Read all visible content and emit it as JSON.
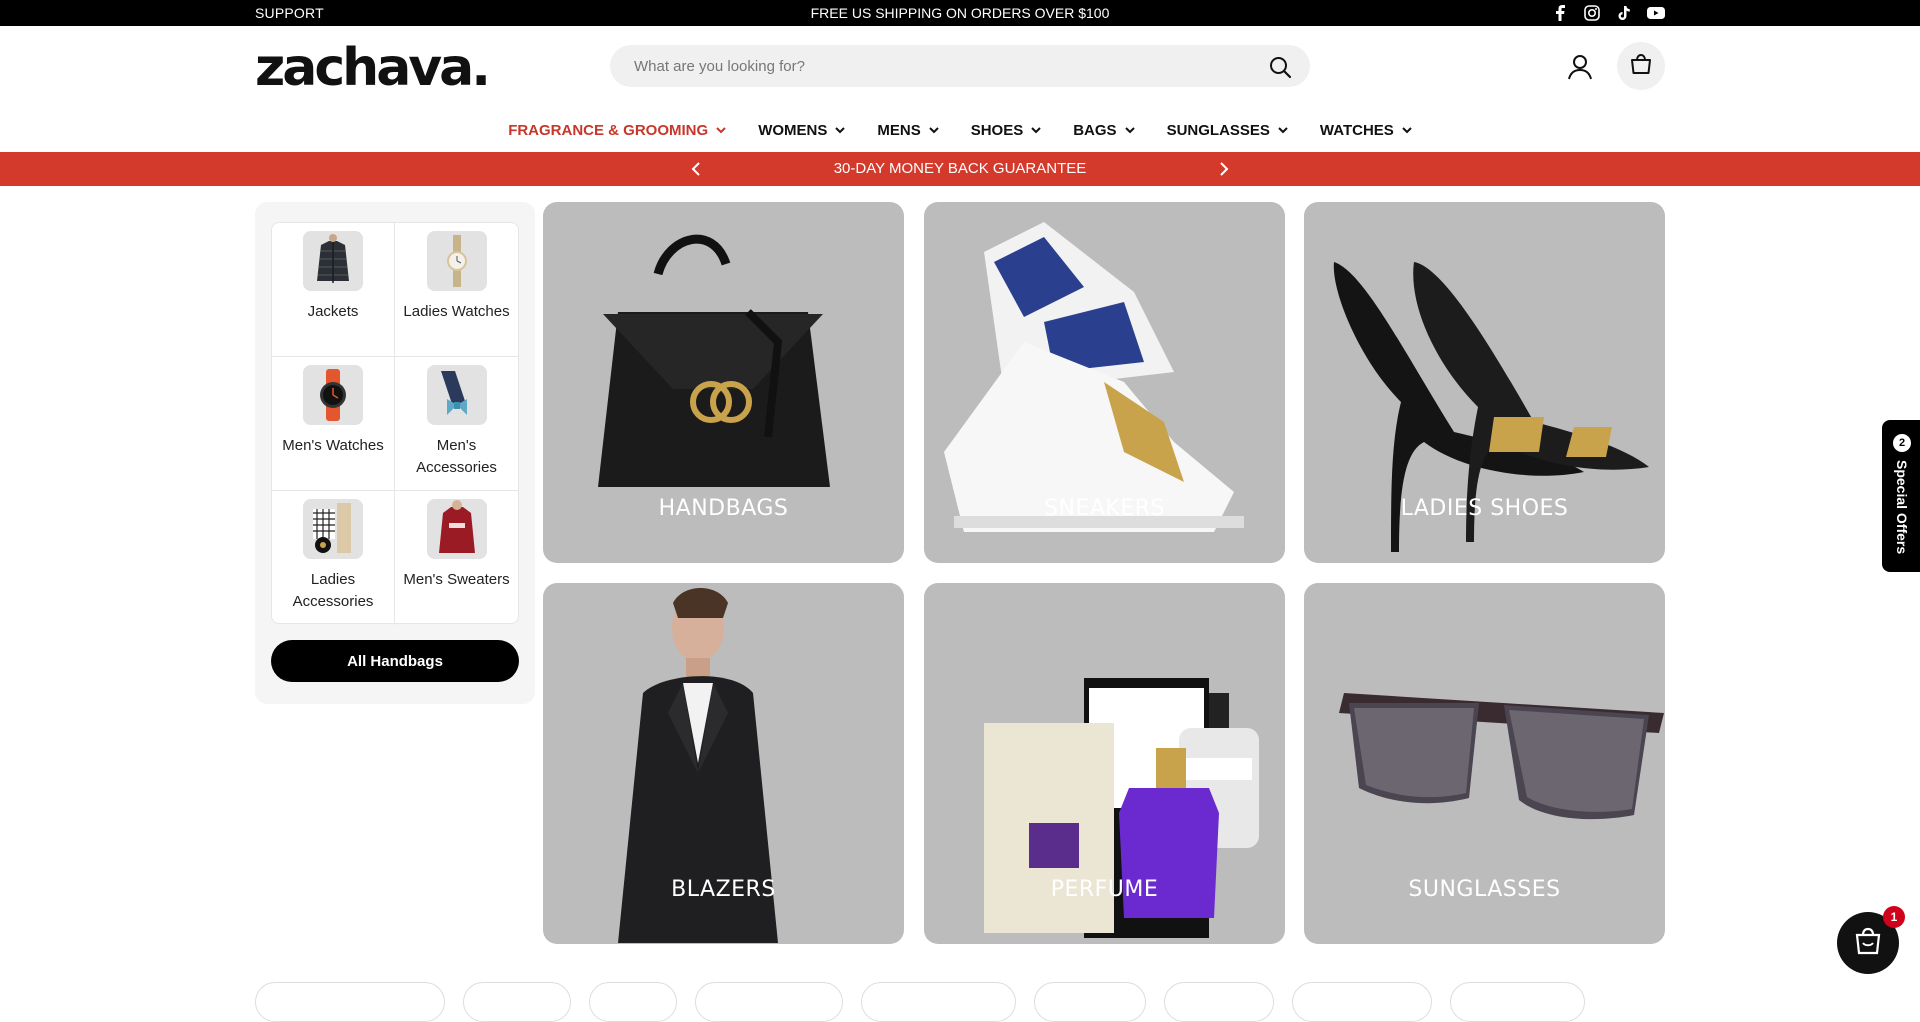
{
  "topbar": {
    "support": "SUPPORT",
    "shipping": "FREE US SHIPPING ON ORDERS OVER $100",
    "social": [
      "facebook-icon",
      "instagram-icon",
      "tiktok-icon",
      "youtube-icon"
    ]
  },
  "header": {
    "logo": "zachava.",
    "search_placeholder": "What are you looking for?"
  },
  "nav": [
    {
      "label": "FRAGRANCE & GROOMING",
      "active": true
    },
    {
      "label": "WOMENS"
    },
    {
      "label": "MENS"
    },
    {
      "label": "SHOES"
    },
    {
      "label": "BAGS"
    },
    {
      "label": "SUNGLASSES"
    },
    {
      "label": "WATCHES"
    }
  ],
  "promo": {
    "text": "30-DAY MONEY BACK GUARANTEE"
  },
  "sidebar": {
    "items": [
      {
        "label": "Jackets"
      },
      {
        "label": "Ladies Watches"
      },
      {
        "label": "Men's Watches"
      },
      {
        "label": "Men's Accessories"
      },
      {
        "label": "Ladies Accessories"
      },
      {
        "label": "Men's Sweaters"
      }
    ],
    "button": "All Handbags"
  },
  "tiles": [
    {
      "label": "HANDBAGS"
    },
    {
      "label": "SNEAKERS"
    },
    {
      "label": "LADIES SHOES"
    },
    {
      "label": "BLAZERS"
    },
    {
      "label": "PERFUME"
    },
    {
      "label": "SUNGLASSES"
    }
  ],
  "offers": {
    "count": "2",
    "label": "Special Offers"
  },
  "chat": {
    "badge": "1"
  },
  "colors": {
    "accent": "#d33a2c",
    "active_nav": "#c8372a",
    "tile_bg": "#bcbcbc"
  }
}
